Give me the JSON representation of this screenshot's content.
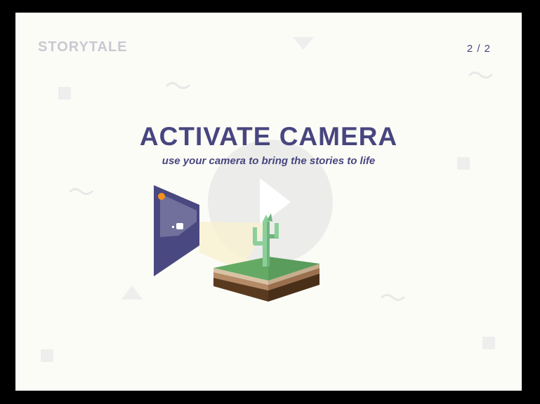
{
  "header": {
    "brand": "STORYTALE",
    "pager": "2 / 2"
  },
  "main": {
    "title": "ACTIVATE CAMERA",
    "subtitle": "use your camera to bring the stories to life"
  },
  "icons": {
    "play": "play-icon",
    "phone": "phone-camera-icon",
    "cactus": "cactus-icon",
    "ground": "ground-block-icon"
  },
  "colors": {
    "background": "#fcfcf7",
    "accent": "#48467f",
    "brand_muted": "#c9c8d2",
    "decor": "#eeeeee",
    "grass": "#64aa64",
    "cactus": "#8ccf9a",
    "soil": "#6b4a2c",
    "flash": "#f5921e"
  }
}
